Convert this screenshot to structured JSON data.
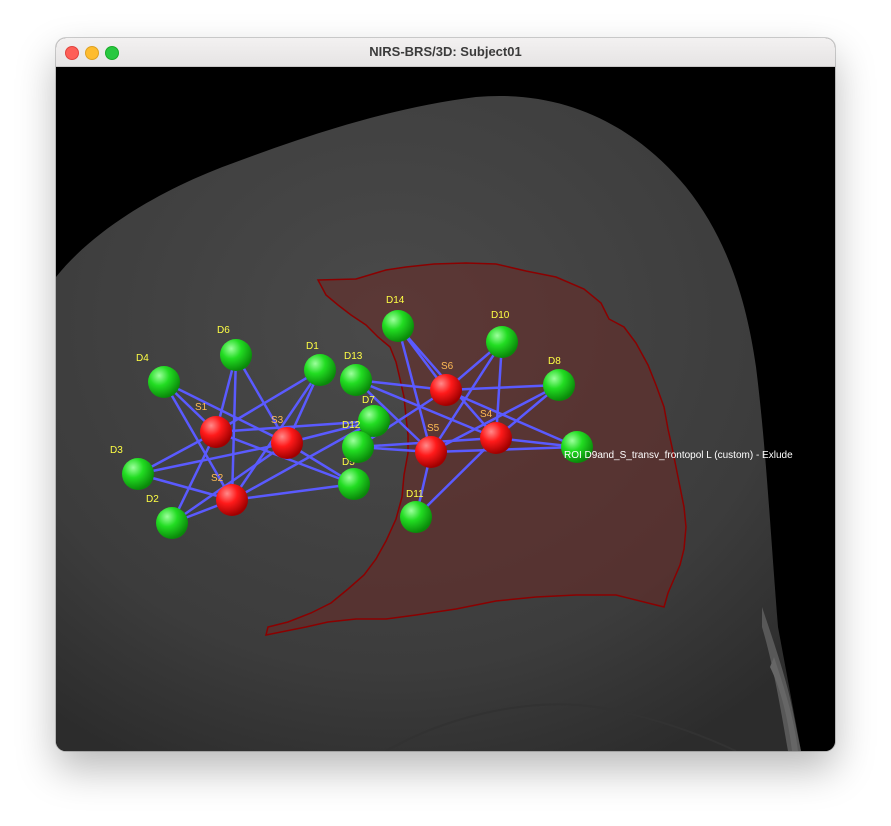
{
  "window": {
    "title": "NIRS-BRS/3D: Subject01"
  },
  "roi_label": "ROI D9and_S_transv_frontopol L (custom) - Exlude",
  "colors": {
    "source": "#ff1a1a",
    "detector": "#22dd22",
    "channel": "#5a5aff",
    "label": "#ffff44",
    "source_label": "#ffbb55",
    "roi_fill": "#6a2a26",
    "roi_edge": "#8b0000",
    "head": "#3e3e3e",
    "background": "#000000"
  },
  "sources": [
    {
      "id": "S1",
      "label": "S1"
    },
    {
      "id": "S2",
      "label": "S2"
    },
    {
      "id": "S3",
      "label": "S3"
    },
    {
      "id": "S4",
      "label": "S4"
    },
    {
      "id": "S5",
      "label": "S5"
    },
    {
      "id": "S6",
      "label": "S6"
    }
  ],
  "detectors": [
    {
      "id": "D1",
      "label": "D1"
    },
    {
      "id": "D2",
      "label": "D2"
    },
    {
      "id": "D3",
      "label": "D3"
    },
    {
      "id": "D4",
      "label": "D4"
    },
    {
      "id": "D5",
      "label": "D5"
    },
    {
      "id": "D6",
      "label": "D6"
    },
    {
      "id": "D7",
      "label": "D7"
    },
    {
      "id": "D8",
      "label": "D8"
    },
    {
      "id": "D10",
      "label": "D10"
    },
    {
      "id": "D11",
      "label": "D11"
    },
    {
      "id": "D12",
      "label": "D12"
    },
    {
      "id": "D13",
      "label": "D13"
    },
    {
      "id": "D14",
      "label": "D14"
    }
  ],
  "channels": [
    [
      "S1",
      "D4"
    ],
    [
      "S1",
      "D6"
    ],
    [
      "S1",
      "D1"
    ],
    [
      "S1",
      "D3"
    ],
    [
      "S1",
      "D2"
    ],
    [
      "S1",
      "D5"
    ],
    [
      "S1",
      "D7"
    ],
    [
      "S2",
      "D3"
    ],
    [
      "S2",
      "D2"
    ],
    [
      "S2",
      "D4"
    ],
    [
      "S2",
      "D6"
    ],
    [
      "S2",
      "D1"
    ],
    [
      "S2",
      "D5"
    ],
    [
      "S2",
      "D7"
    ],
    [
      "S3",
      "D4"
    ],
    [
      "S3",
      "D6"
    ],
    [
      "S3",
      "D1"
    ],
    [
      "S3",
      "D3"
    ],
    [
      "S3",
      "D2"
    ],
    [
      "S3",
      "D5"
    ],
    [
      "S3",
      "D7"
    ],
    [
      "S6",
      "D14"
    ],
    [
      "S6",
      "D10"
    ],
    [
      "S6",
      "D13"
    ],
    [
      "S6",
      "D8"
    ],
    [
      "S6",
      "D12"
    ],
    [
      "S6",
      "D9"
    ],
    [
      "S5",
      "D14"
    ],
    [
      "S5",
      "D10"
    ],
    [
      "S5",
      "D13"
    ],
    [
      "S5",
      "D8"
    ],
    [
      "S5",
      "D12"
    ],
    [
      "S5",
      "D9"
    ],
    [
      "S5",
      "D11"
    ],
    [
      "S4",
      "D14"
    ],
    [
      "S4",
      "D10"
    ],
    [
      "S4",
      "D13"
    ],
    [
      "S4",
      "D8"
    ],
    [
      "S4",
      "D12"
    ],
    [
      "S4",
      "D9"
    ],
    [
      "S4",
      "D11"
    ]
  ]
}
